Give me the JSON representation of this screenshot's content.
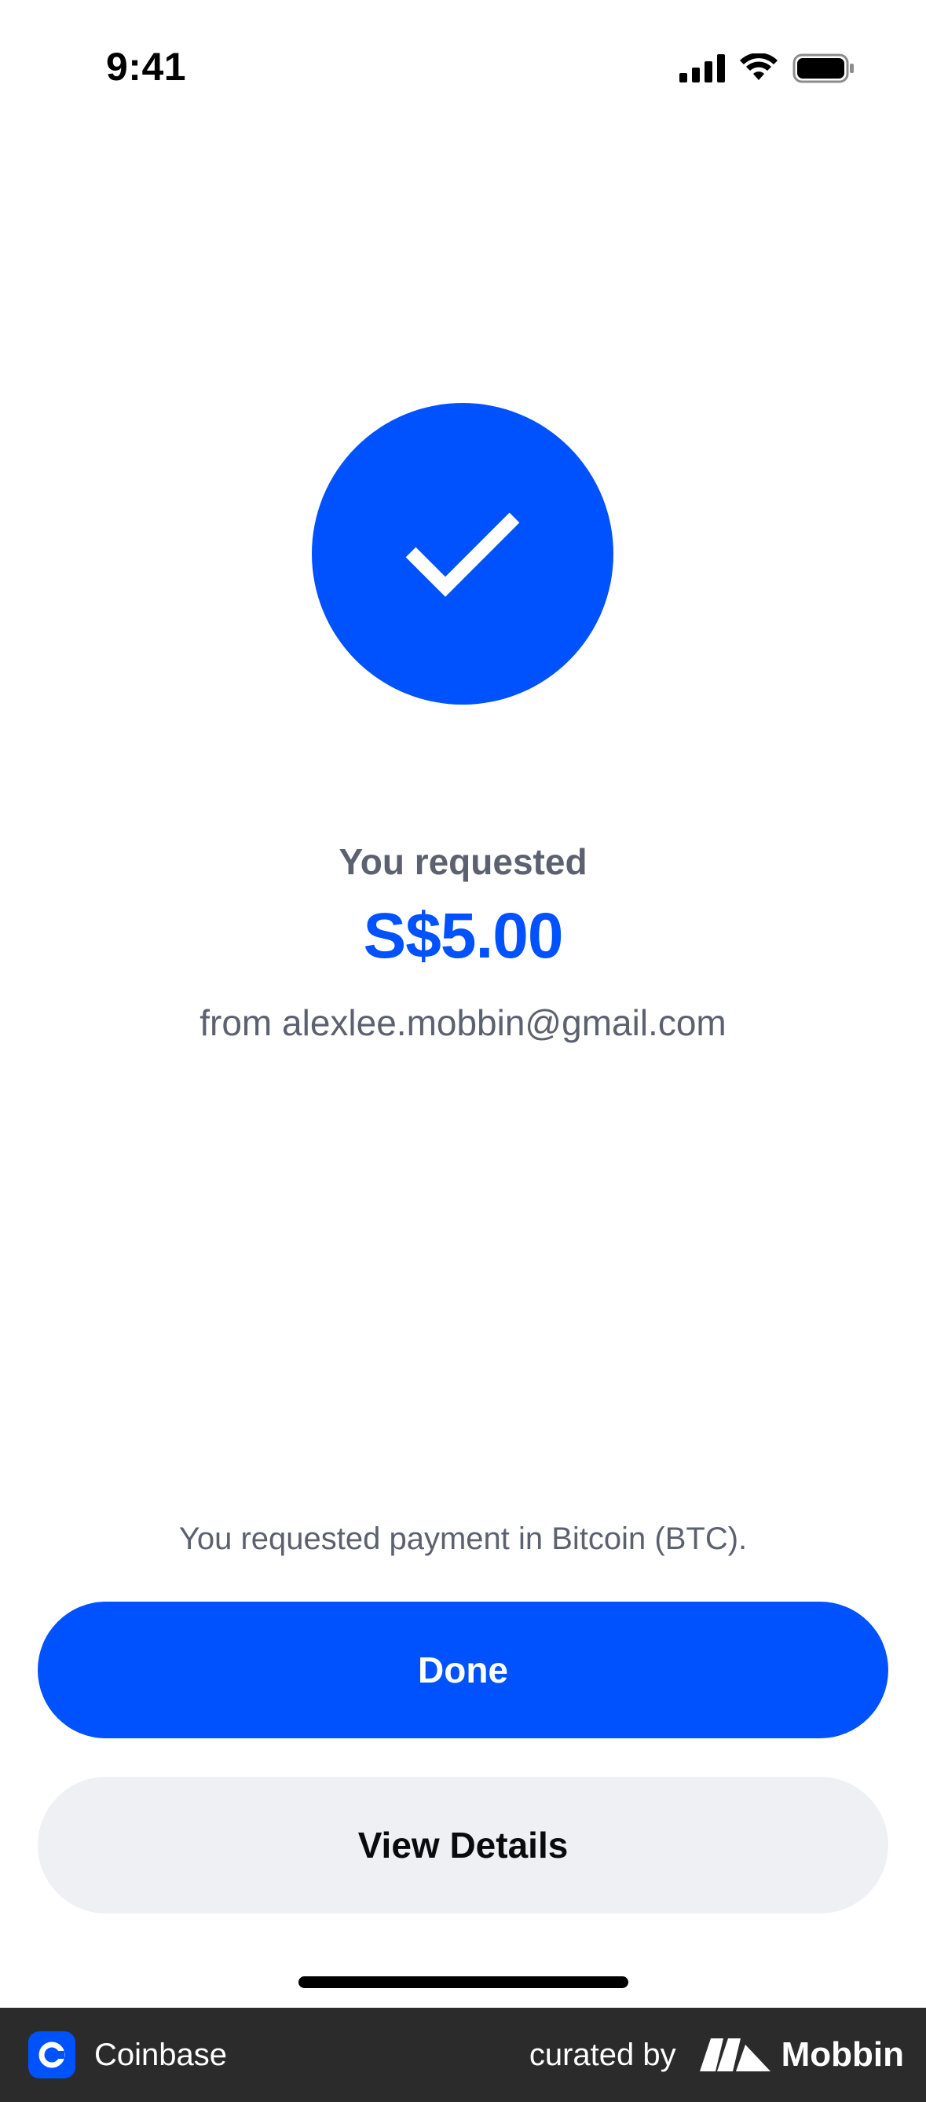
{
  "status_bar": {
    "time": "9:41",
    "icons": [
      "cellular-signal-icon",
      "wifi-icon",
      "battery-icon"
    ]
  },
  "success": {
    "icon": "checkmark-icon",
    "headline": "You requested",
    "amount": "S$5.00",
    "from": "from alexlee.mobbin@gmail.com"
  },
  "note": "You requested payment in Bitcoin (BTC).",
  "actions": {
    "done_label": "Done",
    "view_details_label": "View Details"
  },
  "footer": {
    "app_name": "Coinbase",
    "curated_by": "curated by",
    "brand": "Mobbin"
  },
  "colors": {
    "accent": "#0052FF",
    "secondary_button": "#EEF0F3",
    "muted_text": "#5B616E",
    "footer_bg": "#2B2B2B"
  }
}
